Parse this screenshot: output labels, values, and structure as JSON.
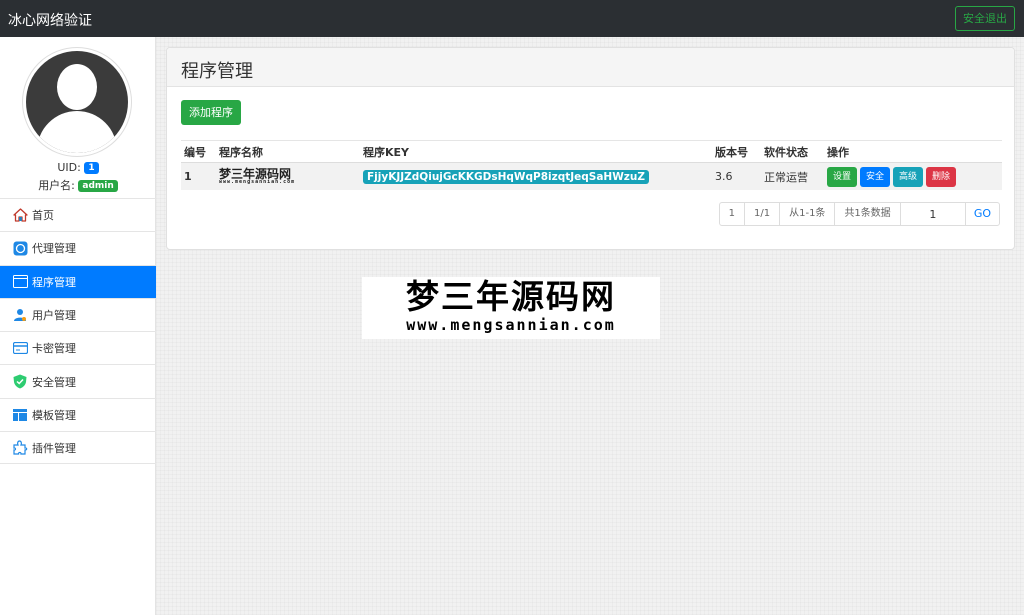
{
  "header": {
    "brand": "冰心网络验证",
    "logout_label": "安全退出"
  },
  "profile": {
    "uid_label": "UID:",
    "uid_value": "1",
    "username_label": "用户名:",
    "username_value": "admin"
  },
  "sidebar": {
    "items": [
      {
        "label": "首页",
        "icon": "home-icon"
      },
      {
        "label": "代理管理",
        "icon": "agent-icon"
      },
      {
        "label": "程序管理",
        "icon": "program-icon",
        "active": true
      },
      {
        "label": "用户管理",
        "icon": "user-icon"
      },
      {
        "label": "卡密管理",
        "icon": "card-icon"
      },
      {
        "label": "安全管理",
        "icon": "shield-icon"
      },
      {
        "label": "模板管理",
        "icon": "template-icon"
      },
      {
        "label": "插件管理",
        "icon": "plugin-icon"
      }
    ]
  },
  "main": {
    "title": "程序管理",
    "add_button": "添加程序",
    "table": {
      "headers": [
        "编号",
        "程序名称",
        "程序KEY",
        "版本号",
        "软件状态",
        "操作"
      ],
      "rows": [
        {
          "id": "1",
          "name": "梦三年源码网",
          "name_sub": "www.mengsannian.com",
          "key": "FjjyKJJZdQiujGcKKGDsHqWqP8izqtJeqSaHWzuZ",
          "version": "3.6",
          "status": "正常运营",
          "actions": [
            "设置",
            "安全",
            "高级",
            "删除"
          ]
        }
      ]
    },
    "pagination": {
      "first": "1",
      "pages": "1/1",
      "range": "从1-1条",
      "total": "共1条数据",
      "page_input": "1",
      "go": "GO"
    }
  },
  "watermark": {
    "title": "梦三年源码网",
    "url": "www.mengsannian.com"
  },
  "colors": {
    "topbar": "#2b2f33",
    "primary": "#007bff",
    "success": "#28a745",
    "info": "#17a2b8",
    "danger": "#dc3545"
  }
}
